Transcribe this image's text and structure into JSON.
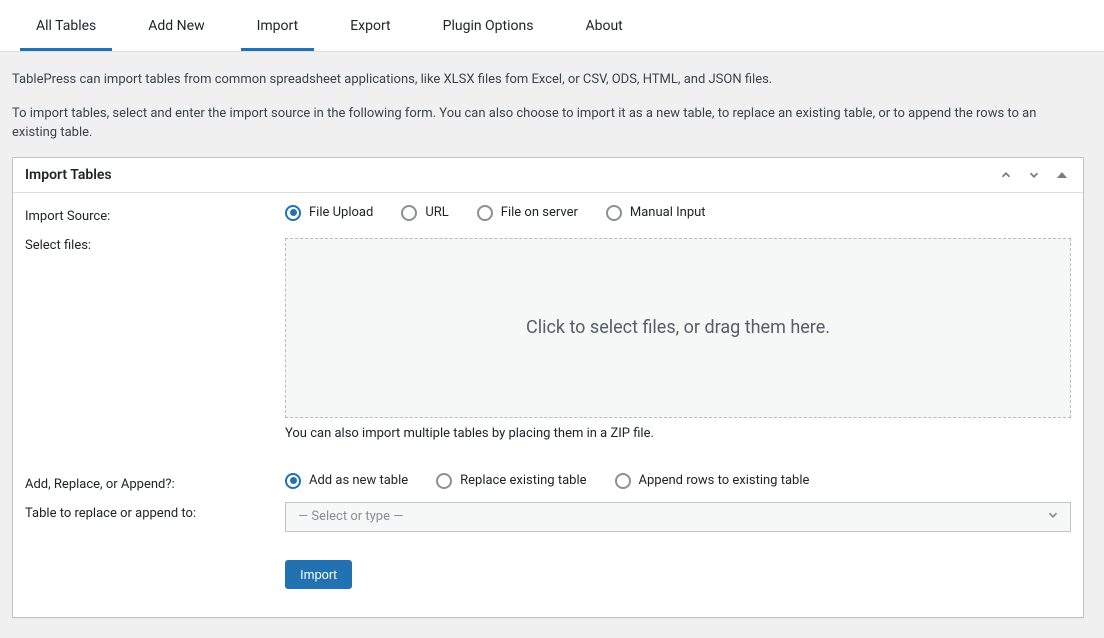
{
  "tabs": {
    "all_tables": "All Tables",
    "add_new": "Add New",
    "import": "Import",
    "export": "Export",
    "plugin_options": "Plugin Options",
    "about": "About"
  },
  "intro": {
    "line1": "TablePress can import tables from common spreadsheet applications, like XLSX files fom Excel, or CSV, ODS, HTML, and JSON files.",
    "line2": "To import tables, select and enter the import source in the following form. You can also choose to import it as a new table, to replace an existing table, or to append the rows to an existing table."
  },
  "panel": {
    "title": "Import Tables"
  },
  "labels": {
    "import_source": "Import Source:",
    "select_files": "Select files:",
    "add_replace": "Add, Replace, or Append?:",
    "table_to_replace": "Table to replace or append to:"
  },
  "source_options": {
    "file_upload": "File Upload",
    "url": "URL",
    "file_on_server": "File on server",
    "manual_input": "Manual Input"
  },
  "dropzone_text": "Click to select files, or drag them here.",
  "zip_hint": "You can also import multiple tables by placing them in a ZIP file.",
  "mode_options": {
    "add_new": "Add as new table",
    "replace": "Replace existing table",
    "append": "Append rows to existing table"
  },
  "select_placeholder": "— Select or type —",
  "import_button": "Import"
}
